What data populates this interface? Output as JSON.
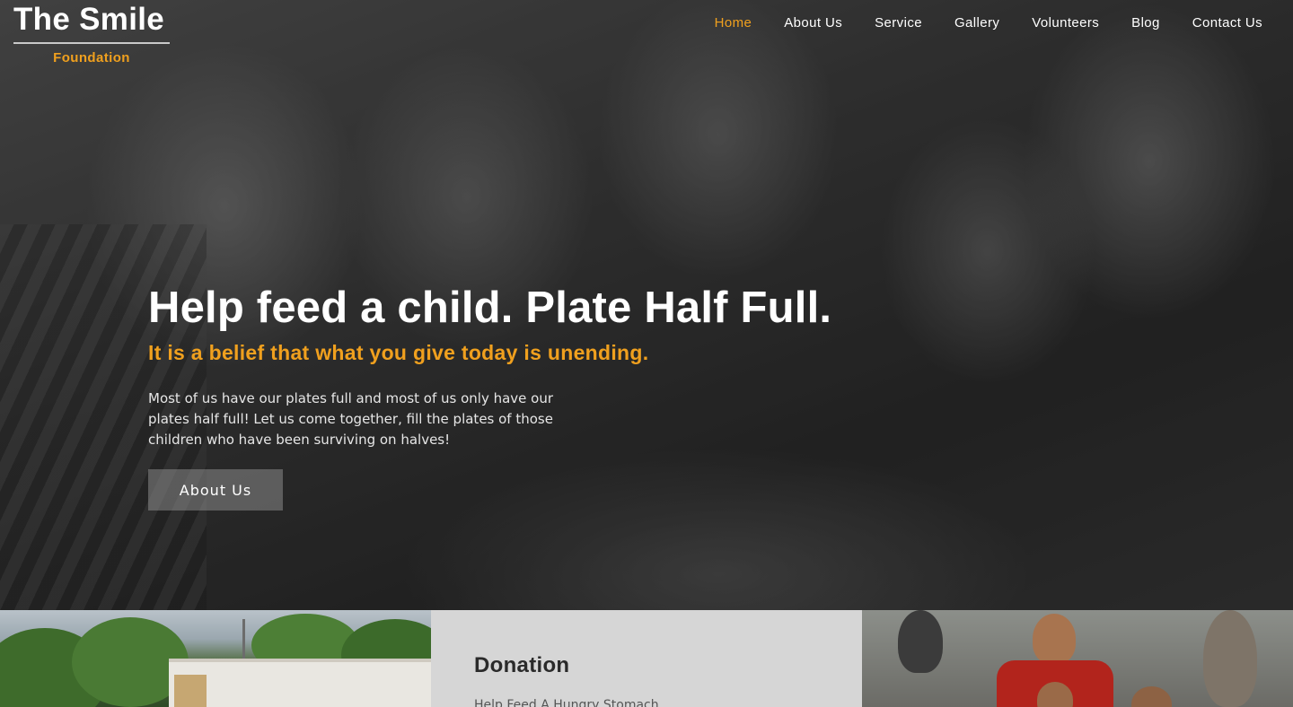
{
  "brand": {
    "title": "The Smile",
    "subtitle": "Foundation"
  },
  "nav": {
    "items": [
      {
        "label": "Home",
        "active": true
      },
      {
        "label": "About Us",
        "active": false
      },
      {
        "label": "Service",
        "active": false
      },
      {
        "label": "Gallery",
        "active": false
      },
      {
        "label": "Volunteers",
        "active": false
      },
      {
        "label": "Blog",
        "active": false
      },
      {
        "label": "Contact Us",
        "active": false
      }
    ]
  },
  "hero": {
    "title": "Help feed a child. Plate Half Full.",
    "subtitle": "It is a belief that what you give today is unending.",
    "body": "Most of us have our plates full and most of us only have our plates half full! Let us come together, fill the plates of those children who have been surviving on halves!",
    "button_label": "About Us"
  },
  "panels": {
    "donation": {
      "title": "Donation",
      "text": "Help Feed A Hungry Stomach"
    }
  },
  "colors": {
    "accent": "#f0a01e",
    "panel_bg": "#d6d6d6"
  }
}
